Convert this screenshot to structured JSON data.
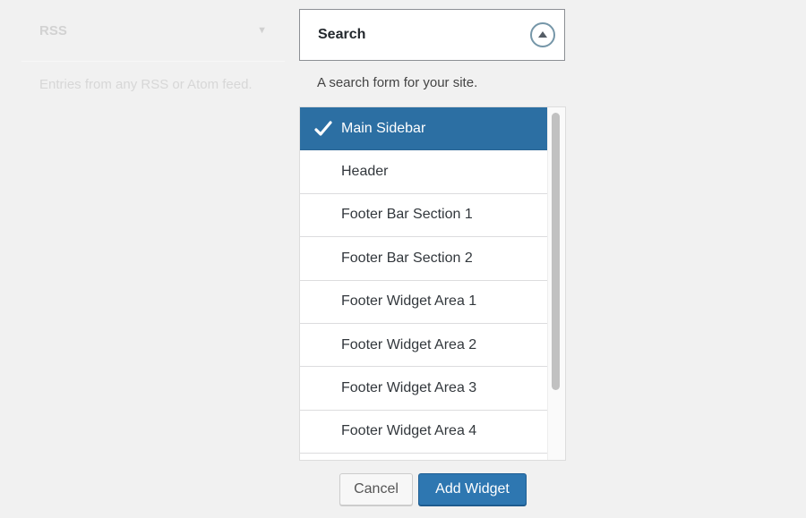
{
  "rss_widget": {
    "title": "RSS",
    "description": "Entries from any RSS or Atom feed."
  },
  "search_widget": {
    "title": "Search",
    "description": "A search form for your site."
  },
  "widget_areas": [
    {
      "label": "Main Sidebar",
      "selected": true
    },
    {
      "label": "Header",
      "selected": false
    },
    {
      "label": "Footer Bar Section 1",
      "selected": false
    },
    {
      "label": "Footer Bar Section 2",
      "selected": false
    },
    {
      "label": "Footer Widget Area 1",
      "selected": false
    },
    {
      "label": "Footer Widget Area 2",
      "selected": false
    },
    {
      "label": "Footer Widget Area 3",
      "selected": false
    },
    {
      "label": "Footer Widget Area 4",
      "selected": false
    },
    {
      "label": "",
      "selected": false
    }
  ],
  "actions": {
    "cancel_label": "Cancel",
    "add_label": "Add Widget"
  },
  "colors": {
    "accent": "#2c6fa3",
    "button_primary": "#2e77b1"
  }
}
